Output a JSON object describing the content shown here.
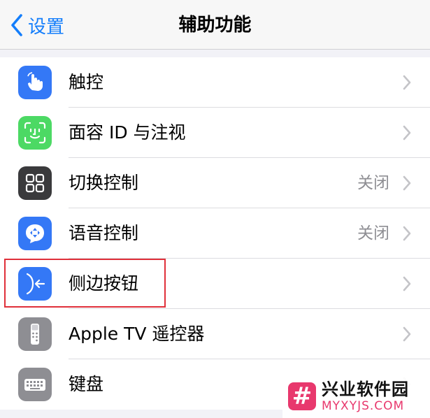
{
  "navbar": {
    "back_label": "设置",
    "title": "辅助功能"
  },
  "rows": [
    {
      "label": "触控",
      "value": "",
      "icon": "touch-hand-icon",
      "color": "#3478f6"
    },
    {
      "label": "面容 ID 与注视",
      "value": "",
      "icon": "face-id-icon",
      "color": "#4cd964"
    },
    {
      "label": "切换控制",
      "value": "关闭",
      "icon": "switch-control-icon",
      "color": "#3a3a3c"
    },
    {
      "label": "语音控制",
      "value": "关闭",
      "icon": "voice-control-icon",
      "color": "#3478f6"
    },
    {
      "label": "侧边按钮",
      "value": "",
      "icon": "side-button-icon",
      "color": "#3478f6"
    },
    {
      "label": "Apple TV 遥控器",
      "value": "",
      "icon": "tv-remote-icon",
      "color": "#8e8e93"
    },
    {
      "label": "键盘",
      "value": "",
      "icon": "keyboard-icon",
      "color": "#8e8e93"
    }
  ],
  "watermark": {
    "logo": "#",
    "name": "兴业软件园",
    "url": "MYXYJS.COM"
  }
}
